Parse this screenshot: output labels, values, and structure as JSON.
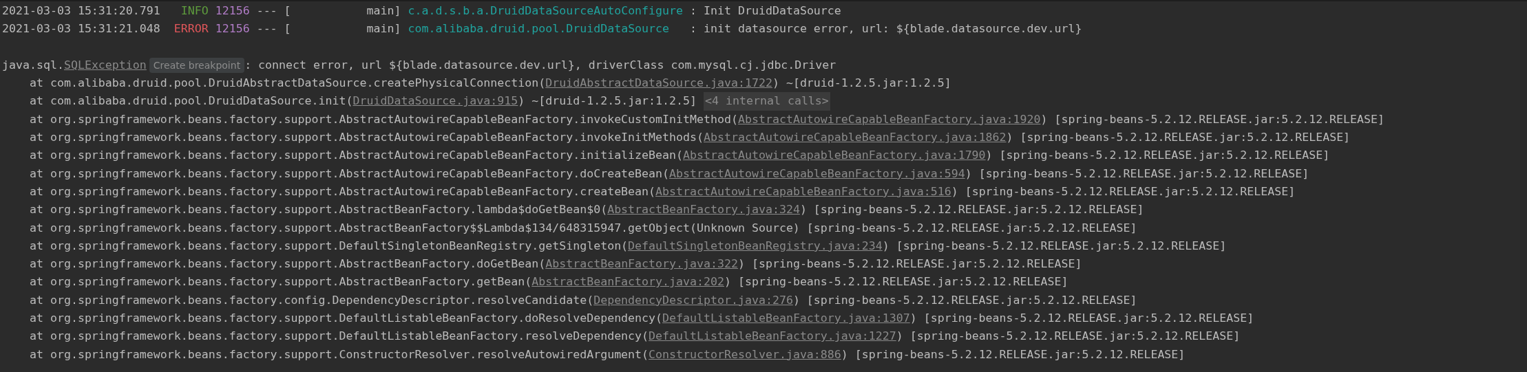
{
  "log_lines": [
    {
      "timestamp": "2021-03-03 15:31:20.791",
      "level": "INFO",
      "kind": "info",
      "pid": "12156",
      "separator": "---",
      "thread": "[           main]",
      "logger": "c.a.d.s.b.a.DruidDataSourceAutoConfigure",
      "message": ": Init DruidDataSource"
    },
    {
      "timestamp": "2021-03-03 15:31:21.048",
      "level": "ERROR",
      "kind": "error",
      "pid": "12156",
      "separator": "---",
      "thread": "[           main]",
      "logger": "com.alibaba.druid.pool.DruidDataSource",
      "message": ": init datasource error, url: ${blade.datasource.dev.url}"
    }
  ],
  "exception": {
    "package": "java.sql.",
    "class": "SQLException",
    "hint": "Create breakpoint",
    "message": ": connect error, url ${blade.datasource.dev.url}, driverClass com.mysql.cj.jdbc.Driver"
  },
  "stack_frames": [
    {
      "text": "at com.alibaba.druid.pool.DruidAbstractDataSource.createPhysicalConnection(",
      "link": "DruidAbstractDataSource.java:1722",
      "suffix": ") ~[druid-1.2.5.jar:1.2.5]"
    },
    {
      "text": "at com.alibaba.druid.pool.DruidDataSource.init(",
      "link": "DruidDataSource.java:915",
      "suffix": ") ~[druid-1.2.5.jar:1.2.5]",
      "folded": "<4 internal calls>"
    },
    {
      "text": "at org.springframework.beans.factory.support.AbstractAutowireCapableBeanFactory.invokeCustomInitMethod(",
      "link": "AbstractAutowireCapableBeanFactory.java:1920",
      "suffix": ") [spring-beans-5.2.12.RELEASE.jar:5.2.12.RELEASE]"
    },
    {
      "text": "at org.springframework.beans.factory.support.AbstractAutowireCapableBeanFactory.invokeInitMethods(",
      "link": "AbstractAutowireCapableBeanFactory.java:1862",
      "suffix": ") [spring-beans-5.2.12.RELEASE.jar:5.2.12.RELEASE]"
    },
    {
      "text": "at org.springframework.beans.factory.support.AbstractAutowireCapableBeanFactory.initializeBean(",
      "link": "AbstractAutowireCapableBeanFactory.java:1790",
      "suffix": ") [spring-beans-5.2.12.RELEASE.jar:5.2.12.RELEASE]"
    },
    {
      "text": "at org.springframework.beans.factory.support.AbstractAutowireCapableBeanFactory.doCreateBean(",
      "link": "AbstractAutowireCapableBeanFactory.java:594",
      "suffix": ") [spring-beans-5.2.12.RELEASE.jar:5.2.12.RELEASE]"
    },
    {
      "text": "at org.springframework.beans.factory.support.AbstractAutowireCapableBeanFactory.createBean(",
      "link": "AbstractAutowireCapableBeanFactory.java:516",
      "suffix": ") [spring-beans-5.2.12.RELEASE.jar:5.2.12.RELEASE]"
    },
    {
      "text": "at org.springframework.beans.factory.support.AbstractBeanFactory.lambda$doGetBean$0(",
      "link": "AbstractBeanFactory.java:324",
      "suffix": ") [spring-beans-5.2.12.RELEASE.jar:5.2.12.RELEASE]"
    },
    {
      "text": "at org.springframework.beans.factory.support.AbstractBeanFactory$$Lambda$134/648315947.getObject(Unknown Source) [spring-beans-5.2.12.RELEASE.jar:5.2.12.RELEASE]"
    },
    {
      "text": "at org.springframework.beans.factory.support.DefaultSingletonBeanRegistry.getSingleton(",
      "link": "DefaultSingletonBeanRegistry.java:234",
      "suffix": ") [spring-beans-5.2.12.RELEASE.jar:5.2.12.RELEASE]"
    },
    {
      "text": "at org.springframework.beans.factory.support.AbstractBeanFactory.doGetBean(",
      "link": "AbstractBeanFactory.java:322",
      "suffix": ") [spring-beans-5.2.12.RELEASE.jar:5.2.12.RELEASE]"
    },
    {
      "text": "at org.springframework.beans.factory.support.AbstractBeanFactory.getBean(",
      "link": "AbstractBeanFactory.java:202",
      "suffix": ") [spring-beans-5.2.12.RELEASE.jar:5.2.12.RELEASE]"
    },
    {
      "text": "at org.springframework.beans.factory.config.DependencyDescriptor.resolveCandidate(",
      "link": "DependencyDescriptor.java:276",
      "suffix": ") [spring-beans-5.2.12.RELEASE.jar:5.2.12.RELEASE]"
    },
    {
      "text": "at org.springframework.beans.factory.support.DefaultListableBeanFactory.doResolveDependency(",
      "link": "DefaultListableBeanFactory.java:1307",
      "suffix": ") [spring-beans-5.2.12.RELEASE.jar:5.2.12.RELEASE]"
    },
    {
      "text": "at org.springframework.beans.factory.support.DefaultListableBeanFactory.resolveDependency(",
      "link": "DefaultListableBeanFactory.java:1227",
      "suffix": ") [spring-beans-5.2.12.RELEASE.jar:5.2.12.RELEASE]"
    },
    {
      "text": "at org.springframework.beans.factory.support.ConstructorResolver.resolveAutowiredArgument(",
      "link": "ConstructorResolver.java:886",
      "suffix": ") [spring-beans-5.2.12.RELEASE.jar:5.2.12.RELEASE]"
    }
  ]
}
